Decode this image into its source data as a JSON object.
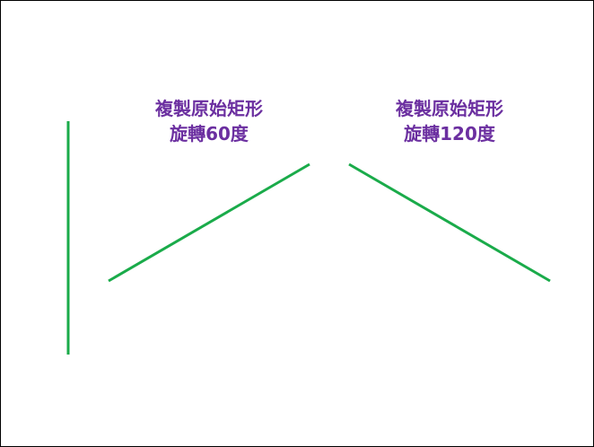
{
  "colors": {
    "line": "#1aab4a",
    "label": "#6b2fa0",
    "border": "#000000",
    "background": "#ffffff"
  },
  "labels": {
    "rotate60": {
      "line1": "複製原始矩形",
      "line2": "旋轉60度"
    },
    "rotate120": {
      "line1": "複製原始矩形",
      "line2": "旋轉120度"
    }
  },
  "shapes": [
    {
      "name": "original-line",
      "angle_deg": 0
    },
    {
      "name": "rotated-60-line",
      "angle_deg": 60
    },
    {
      "name": "rotated-120-line",
      "angle_deg": 120
    }
  ]
}
